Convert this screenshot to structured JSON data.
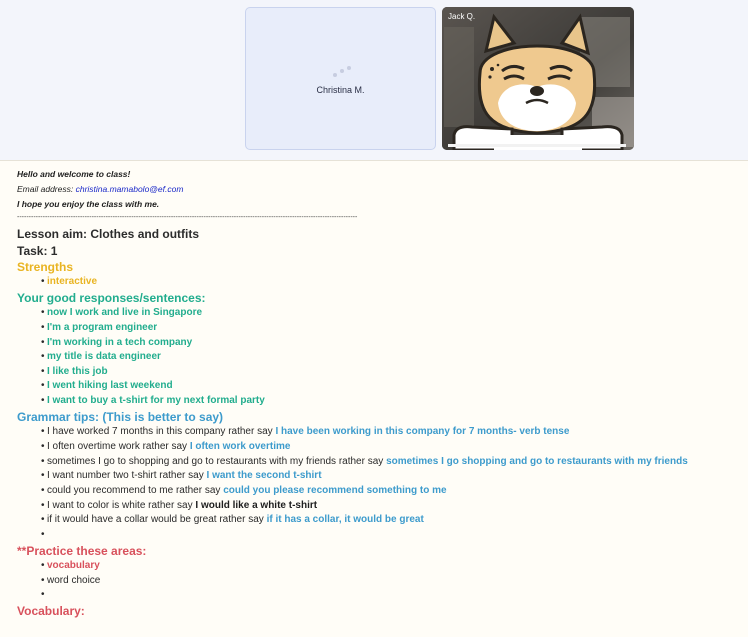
{
  "video": {
    "participant_1": "Christina M.",
    "participant_2": "Jack Q."
  },
  "notes": {
    "greeting": "Hello and welcome to class!",
    "email_label": "Email address: ",
    "email": "christina.mamabolo@ef.com",
    "hope": "I hope you enjoy the class with me.",
    "divider": "--------------------------------------------------------------------------------------------------------------------------------------------------",
    "lesson_aim": "Lesson aim:  Clothes and outfits",
    "task": "Task: 1",
    "strengths_heading": "Strengths",
    "strengths": [
      "interactive"
    ],
    "responses_heading": "Your good responses/sentences:",
    "responses": [
      "now I work and live in Singapore",
      "I'm a program engineer",
      "I'm working in a tech company",
      "my title is data engineer",
      "I like this job",
      "I went hiking last weekend",
      "I want to buy a t-shirt for my next formal party"
    ],
    "grammar_heading": "Grammar tips: (This is better to say)",
    "grammar": [
      {
        "wrong": "I have worked 7 months in this company rather say ",
        "better": "I have been working in this company for 7 months- verb tense"
      },
      {
        "wrong": "I often overtime work rather say ",
        "better": "I often work overtime"
      },
      {
        "wrong": "sometimes I go to shopping and go to restaurants with my friends rather say ",
        "better": "sometimes I go shopping and go to restaurants with my friends"
      },
      {
        "wrong": "I want number two t-shirt rather say ",
        "better": "I want the second t-shirt"
      },
      {
        "wrong": "could you recommend to me rather say ",
        "better": "could you please recommend something to me"
      },
      {
        "wrong": "I want to color is white rather say ",
        "better": "I would like a white t-shirt"
      },
      {
        "wrong": "if it would have a collar would be great rather say ",
        "better": "if it has a collar, it would be great"
      }
    ],
    "practice_heading": "**Practice these areas:",
    "practice": [
      "vocabulary",
      "word choice"
    ],
    "vocabulary_heading": "Vocabulary:"
  },
  "colors": {
    "strengths": "#e9b422",
    "responses": "#22ad8e",
    "grammar": "#3d9bcc",
    "practice": "#d8515c"
  },
  "icons": [
    "loading-dots-icon",
    "doge-avatar-image"
  ]
}
